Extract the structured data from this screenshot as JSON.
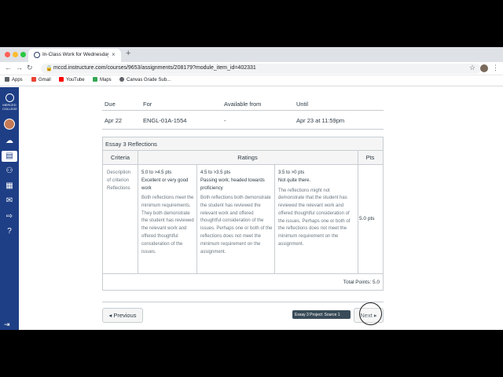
{
  "browser": {
    "tab_title": "In-Class Work for Wednesday",
    "tab_close": "×",
    "new_tab": "+",
    "url": "mccd.instructure.com/courses/9653/assignments/208179?module_item_id=402331",
    "back": "←",
    "forward": "→",
    "reload": "↻",
    "star": "☆",
    "menu": "⋮",
    "lock": "🔒"
  },
  "bookmarks": [
    {
      "label": "Apps",
      "icon_color": "#5f6368"
    },
    {
      "label": "Gmail",
      "icon_color": "#ea4335"
    },
    {
      "label": "YouTube",
      "icon_color": "#ff0000"
    },
    {
      "label": "Maps",
      "icon_color": "#34a853"
    },
    {
      "label": "Canvas Grade Sub...",
      "icon_color": "#5f6368"
    }
  ],
  "sidebar": {
    "logo_text": "MERCED COLLEGE",
    "icons": [
      "dashboard-icon",
      "courses-icon",
      "groups-icon",
      "calendar-icon",
      "inbox-icon",
      "commons-icon",
      "help-icon"
    ],
    "inbox_badge": "49",
    "collapse": "⇥"
  },
  "due_table": {
    "headers": [
      "Due",
      "For",
      "Available from",
      "Until"
    ],
    "row": [
      "Apr 22",
      "ENGL-01A-1554",
      "-",
      "Apr 23 at 11:59pm"
    ]
  },
  "rubric": {
    "title": "Essay 3 Reflections",
    "col_criteria": "Criteria",
    "col_ratings": "Ratings",
    "col_pts": "Pts",
    "criterion_desc": "Description of criterion",
    "criterion_name": "Reflections",
    "ratings": [
      {
        "points": "5.0 to >4.5 pts",
        "name": "Excellent or very good work",
        "desc": "Both reflections meet the minimum requirements. They both demonstrate the student has reviewed the relevant work and offered thoughtful consideration of the issues."
      },
      {
        "points": "4.5 to >3.5 pts",
        "name": "Passing work; headed towards proficiency",
        "desc": "Both reflections both demonstrate the student has reviewed the relevant work and offered thoughtful consideration of the issues. Perhaps one or both of the reflections does not meet the minimum requirement on the assignment."
      },
      {
        "points": "3.5 to >0 pts",
        "name": "Not quite there.",
        "desc": "The reflections might not demonstrate that the student has reviewed the relevant work and offered thoughtful consideration of the issues. Perhaps one or both of the reflections does not meet the minimum requirement on the assignment."
      }
    ],
    "pts_value": "5.0 pts",
    "total": "Total Points: 5.0"
  },
  "footer": {
    "prev_label": "◂ Previous",
    "next_label": "Next ▸",
    "tooltip": "Essay 3 Project: Source 1"
  },
  "colors": {
    "nav_bg": "#1e3f86",
    "border": "#c7cdd1",
    "text": "#2d3b45"
  }
}
